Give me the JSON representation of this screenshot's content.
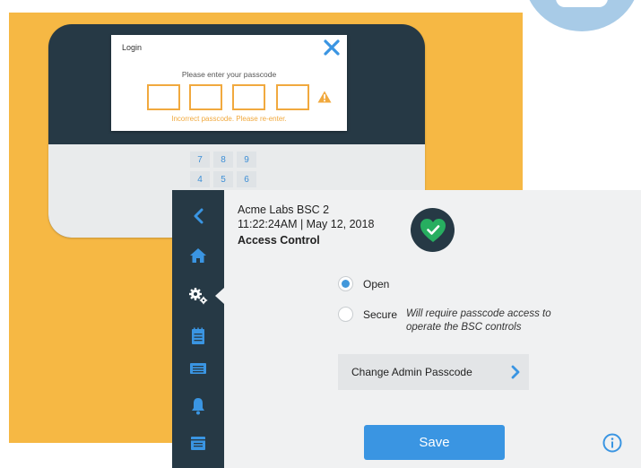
{
  "colors": {
    "orange_background": "#f6b844",
    "sidebar_dark": "#263945",
    "accent_blue": "#3a95e2",
    "warning_orange": "#f1a93e",
    "status_green": "#27ae60"
  },
  "login_dialog": {
    "title": "Login",
    "prompt": "Please enter your passcode",
    "error": "Incorrect passcode. Please re-enter.",
    "passcode_boxes": [
      "",
      "",
      "",
      ""
    ],
    "close_icon": "close-x-icon",
    "warning_icon": "warning-triangle-icon"
  },
  "keypad": {
    "keys": [
      "7",
      "8",
      "9",
      "4",
      "5",
      "6"
    ]
  },
  "sidebar": {
    "items": [
      {
        "icon": "back-chevron-icon",
        "name": "back"
      },
      {
        "icon": "home-icon",
        "name": "home"
      },
      {
        "icon": "settings-gears-icon",
        "name": "settings",
        "active": true
      },
      {
        "icon": "notepad-icon",
        "name": "notes"
      },
      {
        "icon": "display-icon",
        "name": "display"
      },
      {
        "icon": "bell-icon",
        "name": "alerts"
      },
      {
        "icon": "folders-icon",
        "name": "files"
      }
    ]
  },
  "header": {
    "device_name": "Acme Labs BSC 2",
    "datetime": "11:22:24AM | May 12, 2018",
    "section_title": "Access Control",
    "status_icon": "heart-check-icon"
  },
  "access": {
    "options": [
      {
        "label": "Open",
        "selected": true
      },
      {
        "label": "Secure",
        "selected": false
      }
    ],
    "secure_note": "Will require passcode access to operate the BSC controls"
  },
  "change_passcode": {
    "label": "Change Admin Passcode",
    "icon": "chevron-right-icon"
  },
  "save_label": "Save",
  "info_icon": "info-icon"
}
